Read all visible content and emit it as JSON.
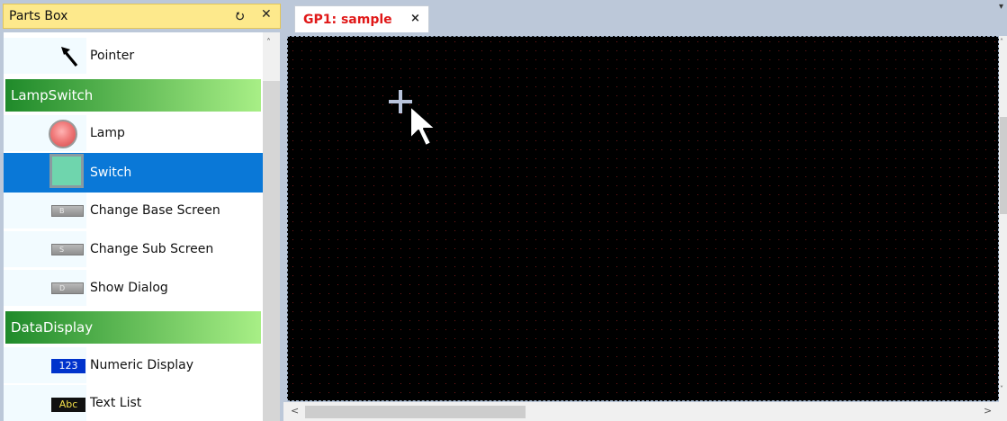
{
  "parts_box": {
    "title": "Parts Box",
    "pin_icon": "pin-icon",
    "close_icon": "close-icon",
    "items": [
      {
        "type": "item",
        "label": "Pointer",
        "icon": "pointer-arrow-icon"
      },
      {
        "type": "category",
        "label": "LampSwitch"
      },
      {
        "type": "item",
        "label": "Lamp",
        "icon": "lamp-icon"
      },
      {
        "type": "item",
        "label": "Switch",
        "icon": "switch-icon",
        "selected": true
      },
      {
        "type": "item",
        "label": "Change Base Screen",
        "icon": "change-base-screen-icon",
        "glyph": "B"
      },
      {
        "type": "item",
        "label": "Change Sub Screen",
        "icon": "change-sub-screen-icon",
        "glyph": "S"
      },
      {
        "type": "item",
        "label": "Show Dialog",
        "icon": "show-dialog-icon",
        "glyph": "D"
      },
      {
        "type": "category",
        "label": "DataDisplay"
      },
      {
        "type": "item",
        "label": "Numeric Display",
        "icon": "numeric-display-icon",
        "glyph": "123"
      },
      {
        "type": "item",
        "label": "Text List",
        "icon": "text-list-icon",
        "glyph": "Abc"
      }
    ]
  },
  "document": {
    "tab_title": "GP1: sample",
    "tab_close": "×",
    "canvas_background": "#000000",
    "grid_dot_color": "#7a1818"
  },
  "colors": {
    "selected_item": "#0a78d7",
    "category_start": "#1f8a2a",
    "category_end": "#a8ef86",
    "panel_title_bg": "#fde98c",
    "tab_title": "#e01818"
  }
}
